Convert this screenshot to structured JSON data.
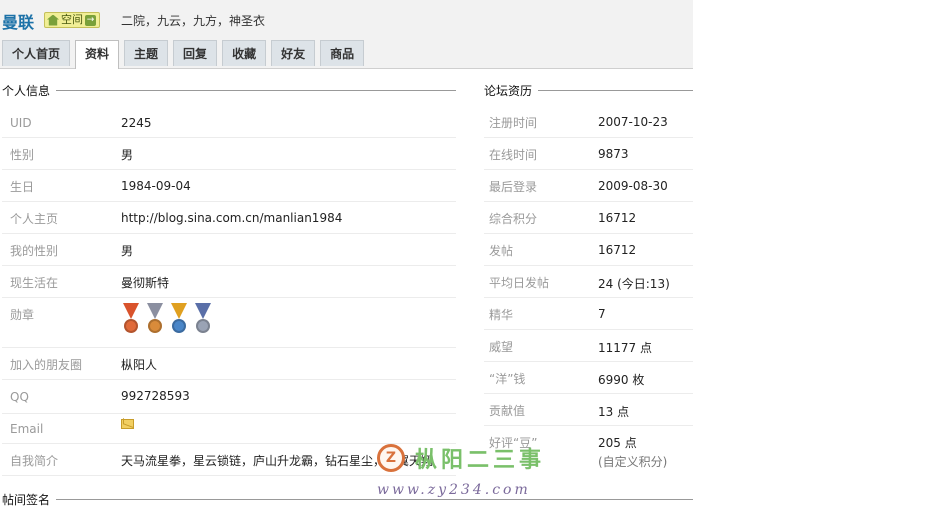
{
  "header": {
    "username": "曼联",
    "space_label": "空间",
    "tagline": "二院，九云，九方，神圣衣"
  },
  "tabs": [
    {
      "label": "个人首页"
    },
    {
      "label": "资料"
    },
    {
      "label": "主题"
    },
    {
      "label": "回复"
    },
    {
      "label": "收藏"
    },
    {
      "label": "好友"
    },
    {
      "label": "商品"
    }
  ],
  "personal": {
    "title": "个人信息",
    "rows": [
      {
        "label": "UID",
        "value": "2245"
      },
      {
        "label": "性别",
        "value": "男"
      },
      {
        "label": "生日",
        "value": "1984-09-04"
      },
      {
        "label": "个人主页",
        "value": "http://blog.sina.com.cn/manlian1984"
      },
      {
        "label": "我的性别",
        "value": "男"
      },
      {
        "label": "现生活在",
        "value": "曼彻斯特"
      },
      {
        "label": "勋章",
        "value": ""
      },
      {
        "label": "加入的朋友圈",
        "value": "枞阳人"
      },
      {
        "label": "QQ",
        "value": "992728593"
      },
      {
        "label": "Email",
        "value": ""
      },
      {
        "label": "自我简介",
        "value": "天马流星拳，星云锁链，庐山升龙霸，钻石星尘，凤翼天翔"
      }
    ],
    "medal_colors": [
      {
        "ribbon": "#d9532c",
        "disc": "#e06a3a"
      },
      {
        "ribbon": "#8b8fa0",
        "disc": "#d98b3a"
      },
      {
        "ribbon": "#e0a020",
        "disc": "#4a86c8"
      },
      {
        "ribbon": "#5a6fa8",
        "disc": "#9aa3b5"
      }
    ]
  },
  "forum": {
    "title": "论坛资历",
    "rows": [
      {
        "label": "注册时间",
        "value": "2007-10-23"
      },
      {
        "label": "在线时间",
        "value": "9873"
      },
      {
        "label": "最后登录",
        "value": "2009-08-30"
      },
      {
        "label": "综合积分",
        "value": "16712"
      },
      {
        "label": "发帖",
        "value": "16712"
      },
      {
        "label": "平均日发帖",
        "value": "24 (今日:13)"
      },
      {
        "label": "精华",
        "value": "7"
      },
      {
        "label": "威望",
        "value": "11177 点"
      },
      {
        "label": "“洋”钱",
        "value": "6990 枚"
      },
      {
        "label": "贡献值",
        "value": "13 点"
      },
      {
        "label": "好评“豆”",
        "value": "205 点",
        "note": "(自定义积分)"
      }
    ]
  },
  "signature": {
    "title": "帖间签名"
  },
  "watermark": {
    "text": "枞阳二三事",
    "url": "www.zy234.com",
    "logo_char": "Z"
  },
  "colors": {
    "link": "#1d72a8",
    "label": "#9a9a9a",
    "header_bg": "#f2f2f2",
    "tab_bg": "#dde3e8"
  }
}
